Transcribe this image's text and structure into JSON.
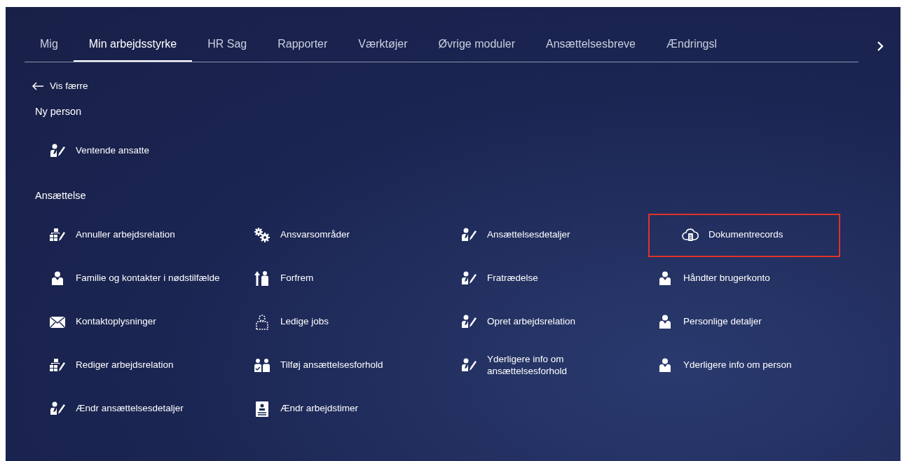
{
  "tabs": [
    {
      "label": "Mig",
      "selected": false
    },
    {
      "label": "Min arbejdsstyrke",
      "selected": true
    },
    {
      "label": "HR Sag",
      "selected": false
    },
    {
      "label": "Rapporter",
      "selected": false
    },
    {
      "label": "Værktøjer",
      "selected": false
    },
    {
      "label": "Øvrige moduler",
      "selected": false
    },
    {
      "label": "Ansættelsesbreve",
      "selected": false
    },
    {
      "label": "Ændringsl",
      "selected": false
    }
  ],
  "back_link": {
    "label": "Vis færre"
  },
  "sections": [
    {
      "title": "Ny person",
      "items": [
        {
          "label": "Ventende ansatte",
          "kind": "personedit",
          "highlighted": false
        }
      ]
    },
    {
      "title": "Ansættelse",
      "items": [
        {
          "label": "Annuller arbejdsrelation",
          "kind": "orgedit",
          "highlighted": false
        },
        {
          "label": "Ansvarsområder",
          "kind": "gears",
          "highlighted": false
        },
        {
          "label": "Ansættelsesdetaljer",
          "kind": "personedit",
          "highlighted": false
        },
        {
          "label": "Dokumentrecords",
          "kind": "clouddoc",
          "highlighted": true
        },
        {
          "label": "Familie og kontakter i nødstilfælde",
          "kind": "person",
          "highlighted": false
        },
        {
          "label": "Forfrem",
          "kind": "promote",
          "highlighted": false
        },
        {
          "label": "Fratrædelse",
          "kind": "personedit",
          "highlighted": false
        },
        {
          "label": "Håndter brugerkonto",
          "kind": "person",
          "highlighted": false
        },
        {
          "label": "Kontaktoplysninger",
          "kind": "envelope",
          "highlighted": false
        },
        {
          "label": "Ledige jobs",
          "kind": "vacant",
          "highlighted": false
        },
        {
          "label": "Opret arbejdsrelation",
          "kind": "personedit",
          "highlighted": false
        },
        {
          "label": "Personlige detaljer",
          "kind": "person",
          "highlighted": false
        },
        {
          "label": "Rediger arbejdsrelation",
          "kind": "orgedit",
          "highlighted": false
        },
        {
          "label": "Tilføj ansættelsesforhold",
          "kind": "twopersons",
          "highlighted": false
        },
        {
          "label": "Yderligere info om ansættelsesforhold",
          "kind": "personedit",
          "highlighted": false
        },
        {
          "label": "Yderligere info om person",
          "kind": "person",
          "highlighted": false
        },
        {
          "label": "Ændr ansættelsesdetaljer",
          "kind": "personedit",
          "highlighted": false
        },
        {
          "label": "Ændr arbejdstimer",
          "kind": "badge",
          "highlighted": false
        }
      ]
    }
  ]
}
